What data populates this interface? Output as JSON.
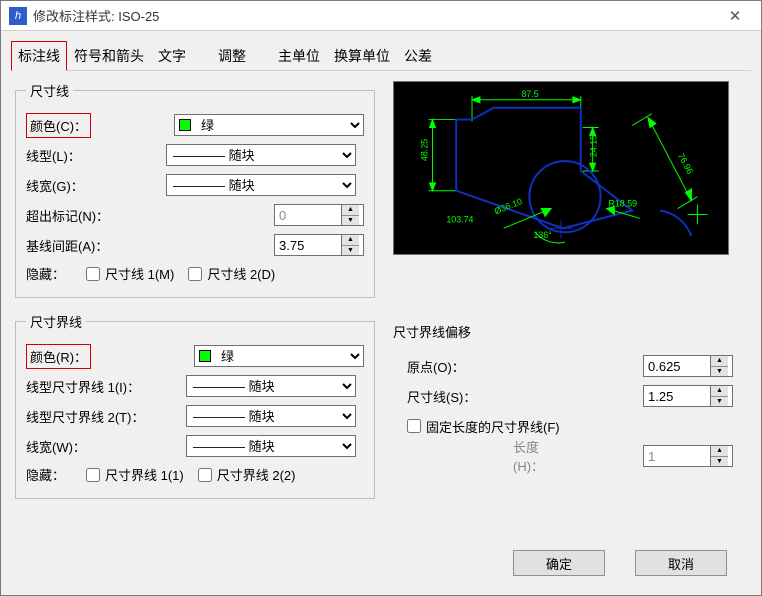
{
  "window": {
    "title": "修改标注样式: ISO-25"
  },
  "tabs": {
    "items": [
      "标注线",
      "符号和箭头",
      "文字",
      "调整",
      "主单位",
      "换算单位",
      "公差"
    ],
    "active": 0
  },
  "dimLines": {
    "legend": "尺寸线",
    "colorLabel": "颜色(C)：",
    "colorValue": "绿",
    "linetypeLabel": "线型(L)：",
    "linetypeValue": "———— 随块",
    "lineweightLabel": "线宽(G)：",
    "lineweightValue": "———— 随块",
    "extendLabel": "超出标记(N)：",
    "extendValue": "0",
    "baselineLabel": "基线间距(A)：",
    "baselineValue": "3.75",
    "hideLabel": "隐藏：",
    "hide1": "尺寸线 1(M)",
    "hide2": "尺寸线 2(D)"
  },
  "extLines": {
    "legend": "尺寸界线",
    "colorLabel": "颜色(R)：",
    "colorValue": "绿",
    "lt1Label": "线型尺寸界线 1(I)：",
    "lt1Value": "———— 随块",
    "lt2Label": "线型尺寸界线 2(T)：",
    "lt2Value": "———— 随块",
    "lwLabel": "线宽(W)：",
    "lwValue": "———— 随块",
    "hideLabel": "隐藏：",
    "hide1": "尺寸界线 1(1)",
    "hide2": "尺寸界线 2(2)"
  },
  "offset": {
    "legend": "尺寸界线偏移",
    "originLabel": "原点(O)：",
    "originValue": "0.625",
    "dimLabel": "尺寸线(S)：",
    "dimValue": "1.25",
    "fixedLabel": "固定长度的尺寸界线(F)",
    "lengthLabel": "长度(H)：",
    "lengthValue": "1"
  },
  "preview": {
    "dims": {
      "top": "87.5",
      "left": "48.25",
      "right": "24.15",
      "diag": "76.96",
      "dia": "Ø36.10",
      "ang": "136°",
      "rad": "R18.59",
      "bl": "103.74"
    }
  },
  "footer": {
    "ok": "确定",
    "cancel": "取消"
  }
}
